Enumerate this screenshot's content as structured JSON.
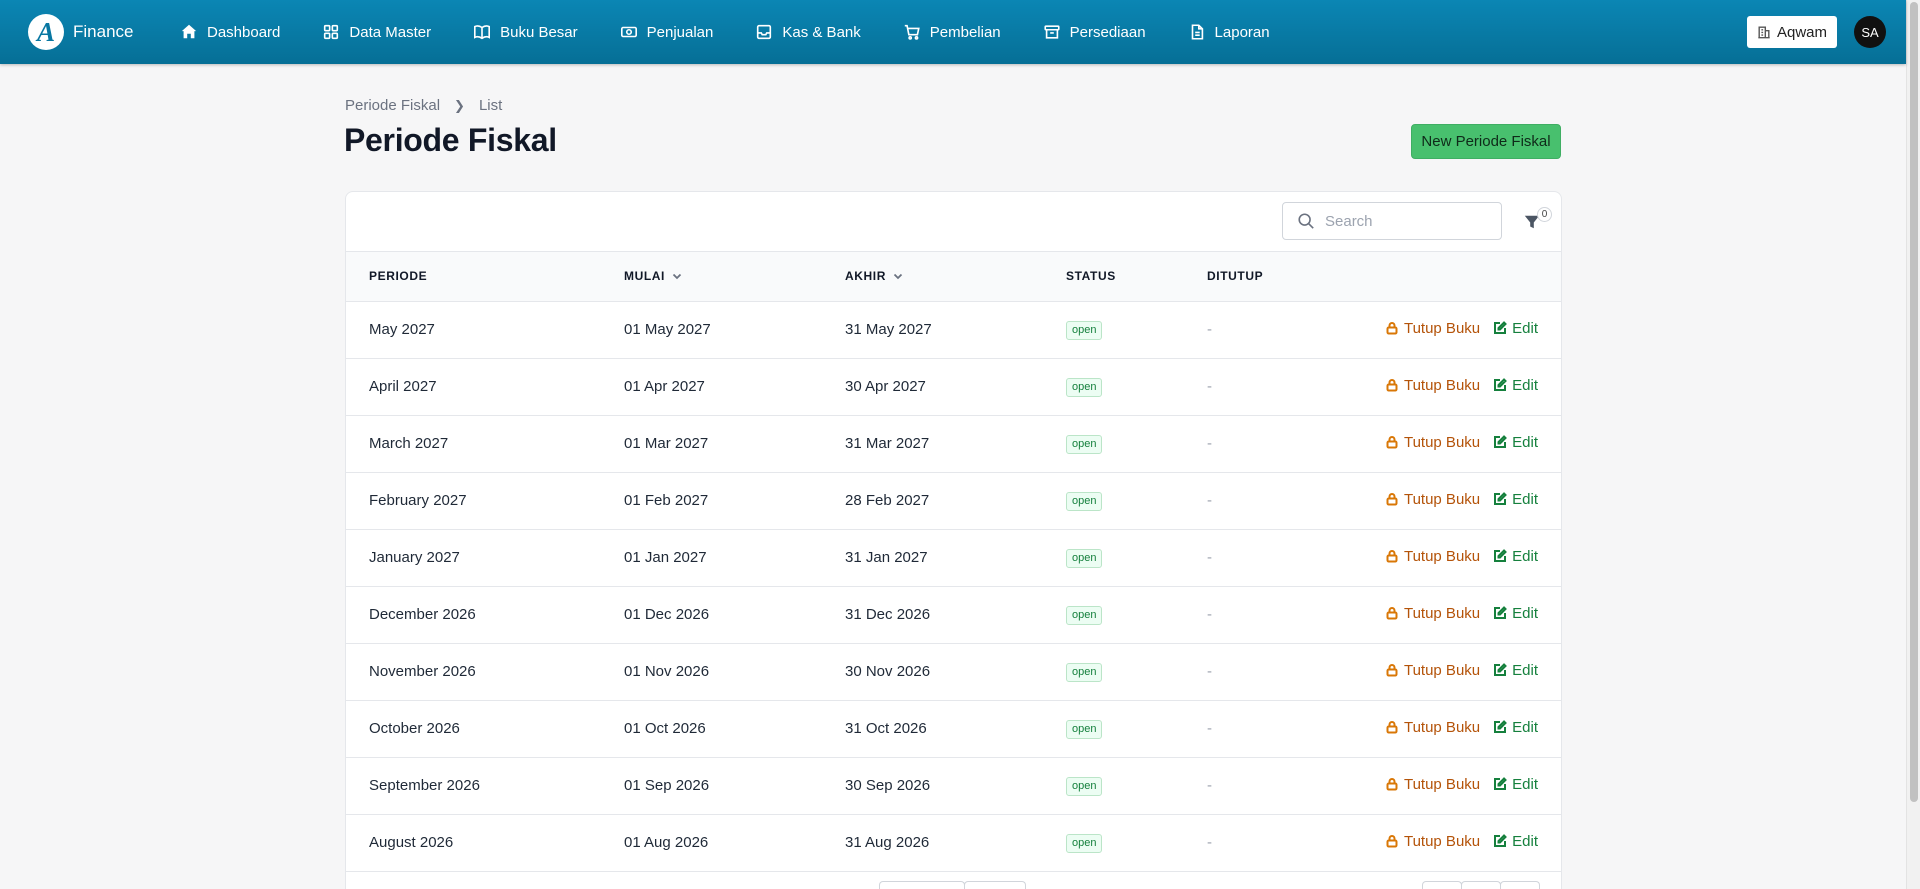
{
  "app": {
    "logo_letter": "A",
    "name": "Finance"
  },
  "nav": [
    {
      "label": "Dashboard",
      "icon": "home-icon"
    },
    {
      "label": "Data Master",
      "icon": "grid-icon"
    },
    {
      "label": "Buku Besar",
      "icon": "book-icon"
    },
    {
      "label": "Penjualan",
      "icon": "cash-icon"
    },
    {
      "label": "Kas & Bank",
      "icon": "inbox-icon"
    },
    {
      "label": "Pembelian",
      "icon": "cart-icon"
    },
    {
      "label": "Persediaan",
      "icon": "archive-icon"
    },
    {
      "label": "Laporan",
      "icon": "document-icon"
    }
  ],
  "company": {
    "label": "Aqwam"
  },
  "user": {
    "initials": "SA"
  },
  "breadcrumb": {
    "parent": "Periode Fiskal",
    "current": "List"
  },
  "page": {
    "title": "Periode Fiskal",
    "new_button": "New Periode Fiskal"
  },
  "search": {
    "placeholder": "Search",
    "value": ""
  },
  "filter": {
    "count": "0"
  },
  "table": {
    "headers": {
      "periode": "PERIODE",
      "mulai": "MULAI",
      "akhir": "AKHIR",
      "status": "STATUS",
      "ditutup": "DITUTUP"
    },
    "action_close": "Tutup Buku",
    "action_edit": "Edit",
    "rows": [
      {
        "periode": "May 2027",
        "mulai": "01 May 2027",
        "akhir": "31 May 2027",
        "status": "open",
        "ditutup": "-"
      },
      {
        "periode": "April 2027",
        "mulai": "01 Apr 2027",
        "akhir": "30 Apr 2027",
        "status": "open",
        "ditutup": "-"
      },
      {
        "periode": "March 2027",
        "mulai": "01 Mar 2027",
        "akhir": "31 Mar 2027",
        "status": "open",
        "ditutup": "-"
      },
      {
        "periode": "February 2027",
        "mulai": "01 Feb 2027",
        "akhir": "28 Feb 2027",
        "status": "open",
        "ditutup": "-"
      },
      {
        "periode": "January 2027",
        "mulai": "01 Jan 2027",
        "akhir": "31 Jan 2027",
        "status": "open",
        "ditutup": "-"
      },
      {
        "periode": "December 2026",
        "mulai": "01 Dec 2026",
        "akhir": "31 Dec 2026",
        "status": "open",
        "ditutup": "-"
      },
      {
        "periode": "November 2026",
        "mulai": "01 Nov 2026",
        "akhir": "30 Nov 2026",
        "status": "open",
        "ditutup": "-"
      },
      {
        "periode": "October 2026",
        "mulai": "01 Oct 2026",
        "akhir": "31 Oct 2026",
        "status": "open",
        "ditutup": "-"
      },
      {
        "periode": "September 2026",
        "mulai": "01 Sep 2026",
        "akhir": "30 Sep 2026",
        "status": "open",
        "ditutup": "-"
      },
      {
        "periode": "August 2026",
        "mulai": "01 Aug 2026",
        "akhir": "31 Aug 2026",
        "status": "open",
        "ditutup": "-"
      }
    ]
  },
  "colors": {
    "nav_bg": "#0877a2",
    "primary_button": "#48c06e",
    "close_action": "#b45309",
    "edit_action": "#15803d"
  }
}
